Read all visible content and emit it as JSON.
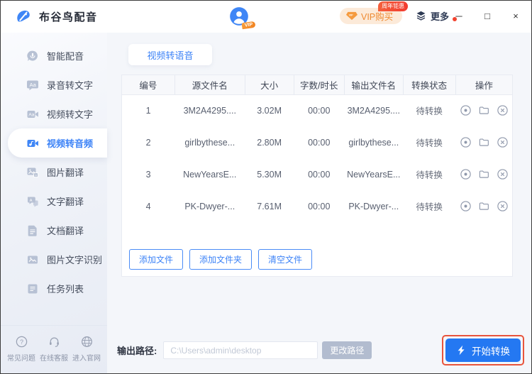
{
  "titlebar": {
    "app_title": "布谷鸟配音",
    "avatar_badge": "VIP",
    "vip_button": "VIP购买",
    "vip_badge": "周年钜惠",
    "more_label": "更多",
    "minimize_glyph": "─",
    "maximize_glyph": "□",
    "close_glyph": "×"
  },
  "sidebar": {
    "items": [
      {
        "id": "ai-dubbing",
        "label": "智能配音",
        "icon": "voice-bubble-icon",
        "active": false
      },
      {
        "id": "audio-to-text",
        "label": "录音转文字",
        "icon": "audio-to-text-icon",
        "active": false
      },
      {
        "id": "video-to-text",
        "label": "视频转文字",
        "icon": "video-to-text-icon",
        "active": false
      },
      {
        "id": "video-to-audio",
        "label": "视频转音频",
        "icon": "video-to-audio-icon",
        "active": true
      },
      {
        "id": "image-translate",
        "label": "图片翻译",
        "icon": "image-translate-icon",
        "active": false
      },
      {
        "id": "text-translate",
        "label": "文字翻译",
        "icon": "text-translate-icon",
        "active": false
      },
      {
        "id": "doc-translate",
        "label": "文档翻译",
        "icon": "doc-translate-icon",
        "active": false
      },
      {
        "id": "image-ocr",
        "label": "图片文字识别",
        "icon": "image-ocr-icon",
        "active": false
      },
      {
        "id": "task-list",
        "label": "任务列表",
        "icon": "task-list-icon",
        "active": false
      }
    ],
    "footer": [
      {
        "id": "faq",
        "label": "常见问题",
        "icon": "question-icon"
      },
      {
        "id": "support",
        "label": "在线客服",
        "icon": "customer-service-icon"
      },
      {
        "id": "website",
        "label": "进入官网",
        "icon": "globe-icon"
      }
    ]
  },
  "main": {
    "tab": "视频转语音",
    "table": {
      "headers": [
        "编号",
        "源文件名",
        "大小",
        "字数/时长",
        "输出文件名",
        "转换状态",
        "操作"
      ],
      "rows": [
        {
          "no": "1",
          "source": "3M2A4295....",
          "size": "3.02M",
          "duration": "00:00",
          "output": "3M2A4295....",
          "status": "待转换"
        },
        {
          "no": "2",
          "source": "girlbythese...",
          "size": "2.80M",
          "duration": "00:00",
          "output": "girlbythese...",
          "status": "待转换"
        },
        {
          "no": "3",
          "source": "NewYearsE...",
          "size": "5.30M",
          "duration": "00:00",
          "output": "NewYearsE...",
          "status": "待转换"
        },
        {
          "no": "4",
          "source": "PK-Dwyer-...",
          "size": "7.61M",
          "duration": "00:00",
          "output": "PK-Dwyer-...",
          "status": "待转换"
        }
      ],
      "row_actions": [
        "preview-icon",
        "open-folder-icon",
        "remove-icon"
      ]
    },
    "actions": [
      {
        "id": "add-file",
        "label": "添加文件"
      },
      {
        "id": "add-folder",
        "label": "添加文件夹"
      },
      {
        "id": "clear-files",
        "label": "清空文件"
      }
    ],
    "footer": {
      "output_path_label": "输出路径:",
      "output_path_value": "C:\\Users\\admin\\desktop",
      "change_path_button": "更改路径",
      "start_button": "开始转换"
    }
  },
  "colors": {
    "accent_blue": "#2478f2",
    "vip_orange": "#ee8a31",
    "badge_red": "#f3442f",
    "annotation_red": "#e8543c",
    "status_gray": "#666c7a"
  }
}
